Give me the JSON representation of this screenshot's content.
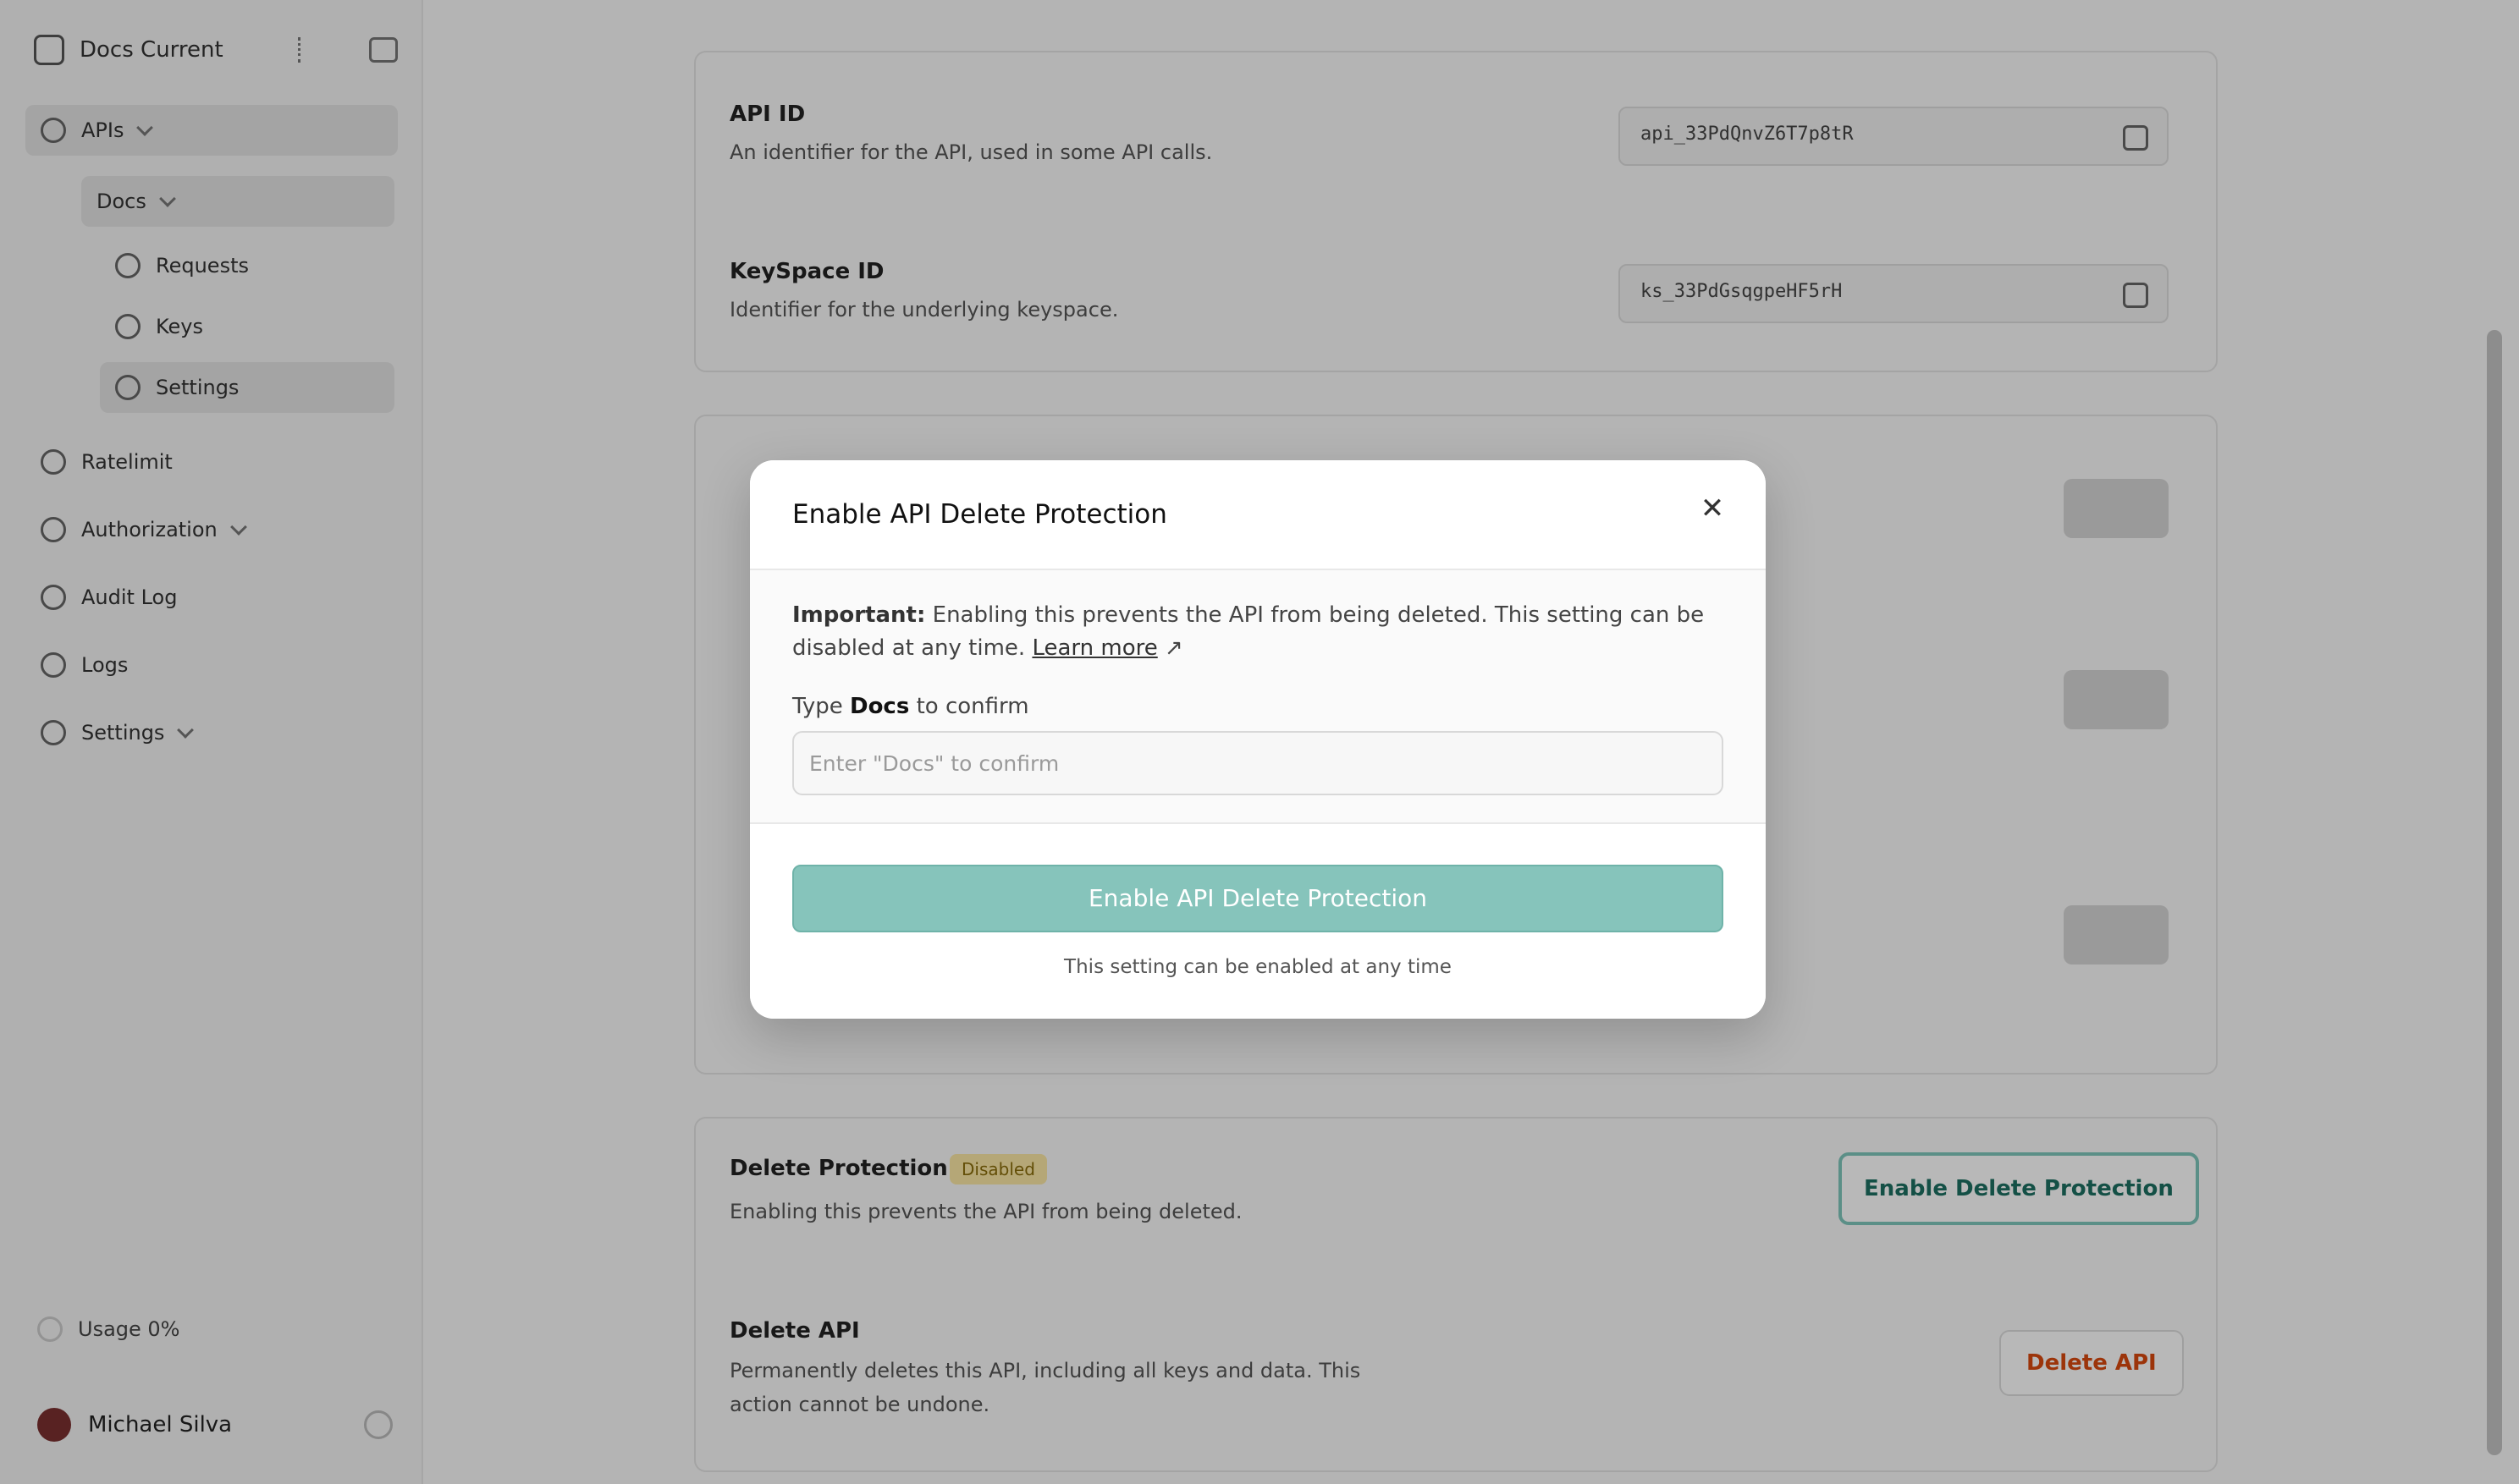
{
  "sidebar": {
    "workspace": "Docs Current",
    "items": [
      {
        "label": "APIs"
      },
      {
        "label": "Docs"
      },
      {
        "label": "Requests"
      },
      {
        "label": "Keys"
      },
      {
        "label": "Settings"
      },
      {
        "label": "Ratelimit"
      },
      {
        "label": "Authorization"
      },
      {
        "label": "Audit Log"
      },
      {
        "label": "Logs"
      },
      {
        "label": "Settings"
      }
    ],
    "usage": "Usage 0%",
    "user": "Michael Silva"
  },
  "settings": {
    "api_id_title": "API ID",
    "api_id_desc": "An identifier for the API, used in some API calls.",
    "api_id_value": "api_33PdQnvZ6T7p8tR",
    "keyspace_title": "KeySpace ID",
    "keyspace_desc": "Identifier for the underlying keyspace.",
    "keyspace_value": "ks_33PdGsqgpeHF5rH",
    "protection_title": "Delete Protection",
    "protection_badge": "Disabled",
    "protection_desc": "Enabling this prevents the API from being deleted.",
    "protection_button": "Enable Delete Protection",
    "delete_title": "Delete API",
    "delete_desc_1": "Permanently deletes this API, including all keys and data. This",
    "delete_desc_2": "action cannot be undone.",
    "delete_button": "Delete API"
  },
  "modal": {
    "title": "Enable API Delete Protection",
    "close_icon": "close-icon",
    "important_label": "Important:",
    "important_text": " Enabling this prevents the API from being deleted. This setting can be disabled at any time. ",
    "learn_more": "Learn more",
    "learn_more_icon": "↗",
    "confirm_prefix": "Type ",
    "confirm_word": "Docs",
    "confirm_suffix": " to confirm",
    "input_placeholder": "Enter \"Docs\" to confirm",
    "input_value": "",
    "submit_label": "Enable API Delete Protection",
    "footer_note": "This setting can be enabled at any time"
  },
  "colors": {
    "accent": "#86c4bb",
    "danger": "#d9480f",
    "badge_bg": "#fbe8a6"
  }
}
